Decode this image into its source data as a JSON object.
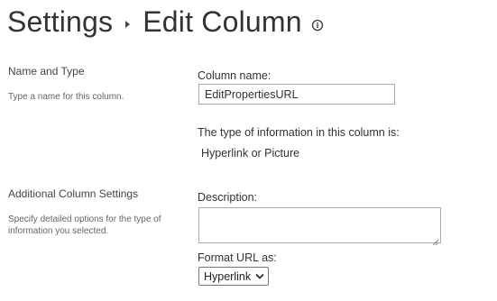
{
  "header": {
    "breadcrumb_root": "Settings",
    "page_title": "Edit Column",
    "info_icon": "info-icon"
  },
  "sections": {
    "name_type": {
      "heading": "Name and Type",
      "description": "Type a name for this column."
    },
    "additional": {
      "heading": "Additional Column Settings",
      "description": "Specify detailed options for the type of information you selected."
    }
  },
  "fields": {
    "column_name": {
      "label": "Column name:",
      "value": "EditPropertiesURL"
    },
    "info_type": {
      "label": "The type of information in this column is:",
      "value": "Hyperlink or Picture"
    },
    "description": {
      "label": "Description:",
      "value": ""
    },
    "format_url": {
      "label": "Format URL as:",
      "selected": "Hyperlink"
    }
  }
}
